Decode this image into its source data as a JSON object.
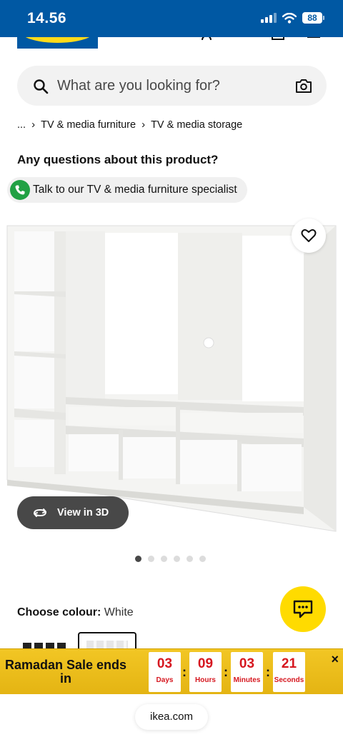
{
  "status_bar": {
    "time": "14.56",
    "battery": "88"
  },
  "header": {
    "logo_text": "IKEA",
    "icons": [
      "account-icon",
      "heart-icon",
      "bag-icon",
      "menu-icon"
    ]
  },
  "search": {
    "placeholder": "What are you looking for?",
    "icon": "search-icon",
    "camera_icon": "camera-icon"
  },
  "breadcrumb": {
    "items": [
      "...",
      "TV & media furniture",
      "TV & media storage"
    ]
  },
  "product": {
    "question": "Any questions about this product?",
    "specialist_label": "Talk to our TV & media furniture specialist",
    "view3d_label": "View in 3D",
    "image_count": 6,
    "active_image": 1
  },
  "colour": {
    "label": "Choose colour:",
    "value": "White"
  },
  "sale_banner": {
    "title": "Ramadan Sale ends in",
    "countdown": [
      {
        "value": "03",
        "unit": "Days"
      },
      {
        "value": "09",
        "unit": "Hours"
      },
      {
        "value": "03",
        "unit": "Minutes"
      },
      {
        "value": "21",
        "unit": "Seconds"
      }
    ],
    "close": "×"
  },
  "browser": {
    "url": "ikea.com"
  },
  "colors": {
    "brand_blue": "#0058a3",
    "brand_yellow": "#ffdb00",
    "countdown_red": "#d6171f",
    "specialist_green": "#21a144"
  }
}
